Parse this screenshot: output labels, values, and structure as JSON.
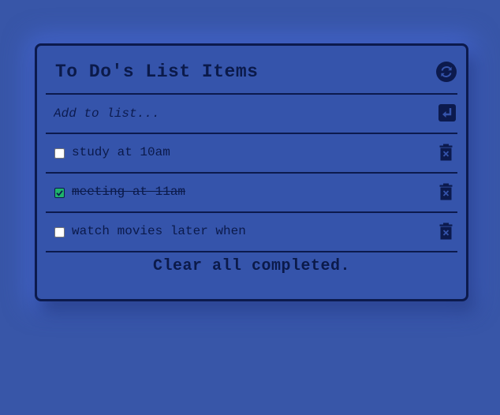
{
  "header": {
    "title": "To Do's List Items",
    "refresh_icon": "refresh-icon"
  },
  "add_field": {
    "placeholder": "Add to list...",
    "value": "",
    "submit_icon": "enter-icon"
  },
  "items": [
    {
      "text": "study at 10am",
      "completed": false
    },
    {
      "text": "meeting at 11am",
      "completed": true
    },
    {
      "text": "watch movies later when",
      "completed": false
    }
  ],
  "footer": {
    "clear_label": "Clear all completed."
  },
  "colors": {
    "background": "#3856a8",
    "card": "#3554ab",
    "ink": "#0b1a4a",
    "checked": "#1fb36b"
  }
}
